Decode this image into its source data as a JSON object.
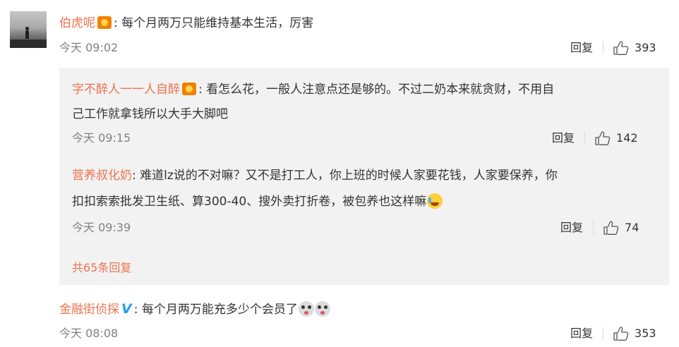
{
  "comments": [
    {
      "user": "伯虎呢",
      "badge_icon": "crown-vip-icon",
      "separator": ":",
      "text": "每个月两万只能维持基本生活，厉害",
      "time": "今天 09:02",
      "reply_label": "回复",
      "likes": "393"
    },
    {
      "user": "金融街侦探",
      "badge_icon": "verified-v-icon",
      "badge_text": "V",
      "separator": ":",
      "text": "每个月两万能充多少个会员了",
      "emoji_icons": [
        "shocked-face-icon",
        "shocked-face-icon"
      ],
      "time": "今天 08:08",
      "reply_label": "回复",
      "likes": "353"
    }
  ],
  "replies": [
    {
      "user": "字不醉人一一人自醉",
      "badge_icon": "crown-vip-icon",
      "separator": ":",
      "text_line1": "看怎么花，一般人注意点还是够的。不过二奶本来就贪财，不用自",
      "text_line2": "己工作就拿钱所以大手大脚吧",
      "time": "今天 09:15",
      "reply_label": "回复",
      "likes": "142"
    },
    {
      "user": "营养叔化奶",
      "separator": ":",
      "text_line1": "难道lz说的不对嘛？又不是打工人，你上班的时候人家要花钱，人家要保养，你",
      "text_line2": "扣扣索索批发卫生纸、算300-40、搜外卖打折卷，被包养也这样嘛",
      "emoji_icon": "laugh-cry-icon",
      "time": "今天 09:39",
      "reply_label": "回复",
      "likes": "74"
    }
  ],
  "more_replies_label": "共65条回复",
  "colors": {
    "username": "#eb7350",
    "time": "#808080",
    "reply_bg": "#f2f2f2"
  }
}
